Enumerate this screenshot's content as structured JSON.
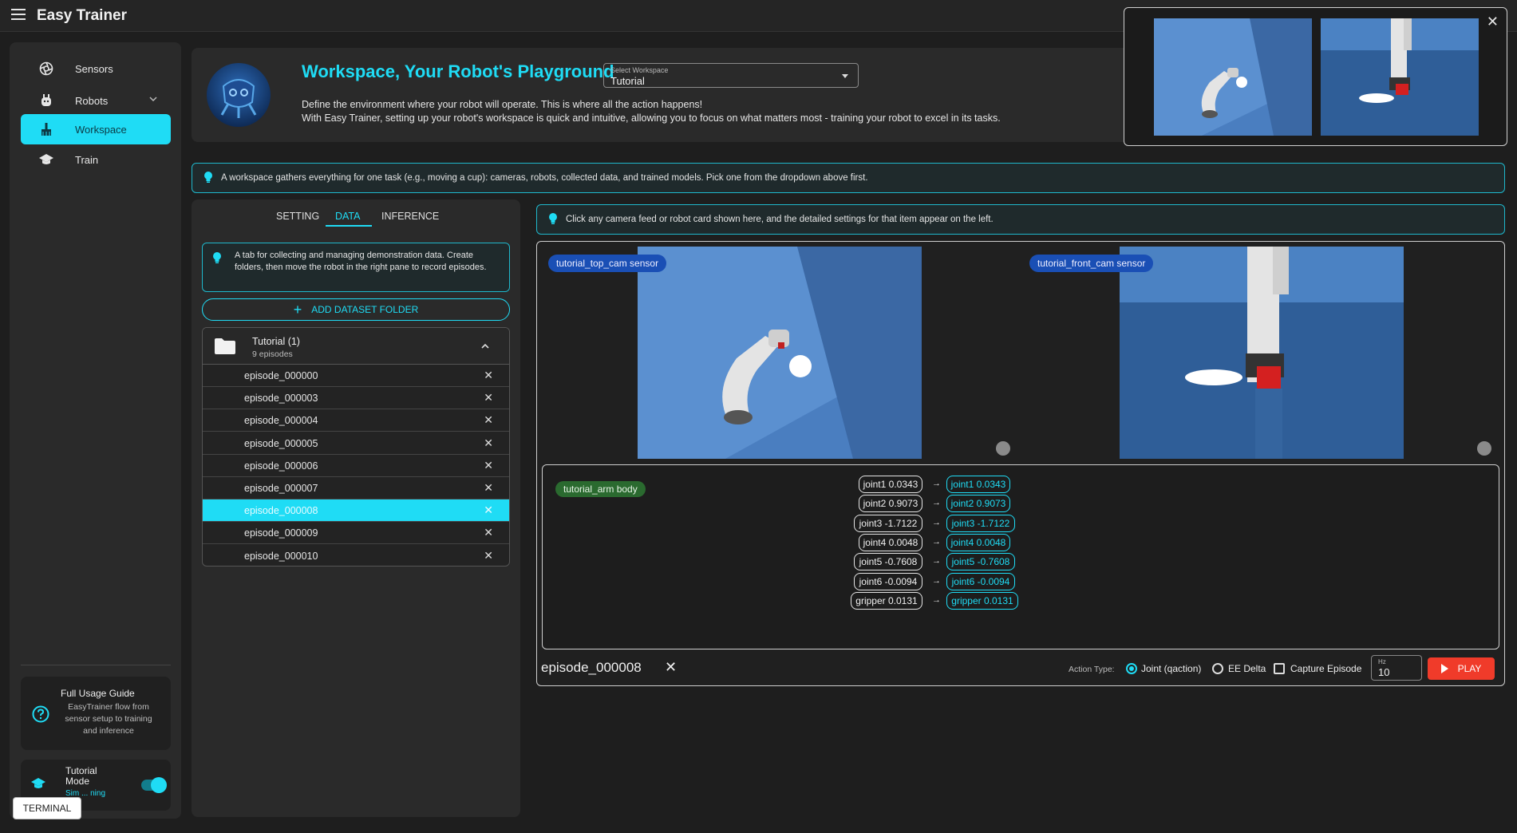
{
  "app": {
    "title": "Easy Trainer"
  },
  "sidebar": {
    "items": [
      {
        "label": "Sensors",
        "icon": "aperture-icon"
      },
      {
        "label": "Robots",
        "icon": "robot-icon"
      },
      {
        "label": "Workspace",
        "icon": "broom-icon",
        "active": true
      },
      {
        "label": "Train",
        "icon": "graduation-cap-icon"
      }
    ],
    "guide": {
      "title": "Full Usage Guide",
      "description": "EasyTrainer flow from sensor setup to training and inference"
    },
    "tutorial": {
      "title": "Tutorial Mode",
      "subtitle": "Sim ... ning",
      "enabled": true
    },
    "terminal_label": "TERMINAL"
  },
  "header": {
    "title": "Workspace, Your Robot's Playground",
    "desc1": "Define the environment where your robot will operate. This is where all the action happens!",
    "desc2": "With Easy Trainer, setting up your robot's workspace is quick and intuitive, allowing you to focus on what matters most - training your robot to excel in its tasks.",
    "select_label": "Select Workspace",
    "select_value": "Tutorial"
  },
  "workspace_info": "A workspace gathers everything for one task (e.g., moving a cup): cameras, robots, collected data, and trained models. Pick one from the dropdown above first.",
  "click_info": "Click any camera feed or robot card shown here, and the detailed settings for that item appear on the left.",
  "tabs": [
    "SETTING",
    "DATA",
    "INFERENCE"
  ],
  "active_tab": "DATA",
  "data_tab": {
    "info": "A tab for collecting and managing demonstration data. Create folders, then move the robot in the right pane to record episodes.",
    "add_folder_label": "ADD DATASET FOLDER",
    "folder": {
      "name": "Tutorial (1)",
      "count": "9 episodes"
    },
    "episodes": [
      "episode_000000",
      "episode_000003",
      "episode_000004",
      "episode_000005",
      "episode_000006",
      "episode_000007",
      "episode_000008",
      "episode_000009",
      "episode_000010"
    ],
    "selected_episode": "episode_000008"
  },
  "cameras": [
    {
      "label": "tutorial_top_cam sensor"
    },
    {
      "label": "tutorial_front_cam sensor"
    }
  ],
  "arm": {
    "label": "tutorial_arm body",
    "joints_source": [
      "joint1 0.0343",
      "joint2 0.9073",
      "joint3 -1.7122",
      "joint4 0.0048",
      "joint5 -0.7608",
      "joint6 -0.0094",
      "gripper 0.0131"
    ],
    "joints_target": [
      "joint1 0.0343",
      "joint2 0.9073",
      "joint3 -1.7122",
      "joint4 0.0048",
      "joint5 -0.7608",
      "joint6 -0.0094",
      "gripper 0.0131"
    ],
    "arrow": "→"
  },
  "player": {
    "episode": "episode_000008",
    "action_type_label": "Action Type:",
    "options": [
      "Joint (qaction)",
      "EE Delta"
    ],
    "selected_option": "Joint (qaction)",
    "capture_label": "Capture Episode",
    "hz_label": "Hz",
    "hz_value": "10",
    "play_label": "PLAY"
  },
  "colors": {
    "accent": "#1fdcf5",
    "play": "#f03b2a",
    "badge_blue": "#1a4fb5",
    "badge_green": "#2a6a2f"
  }
}
